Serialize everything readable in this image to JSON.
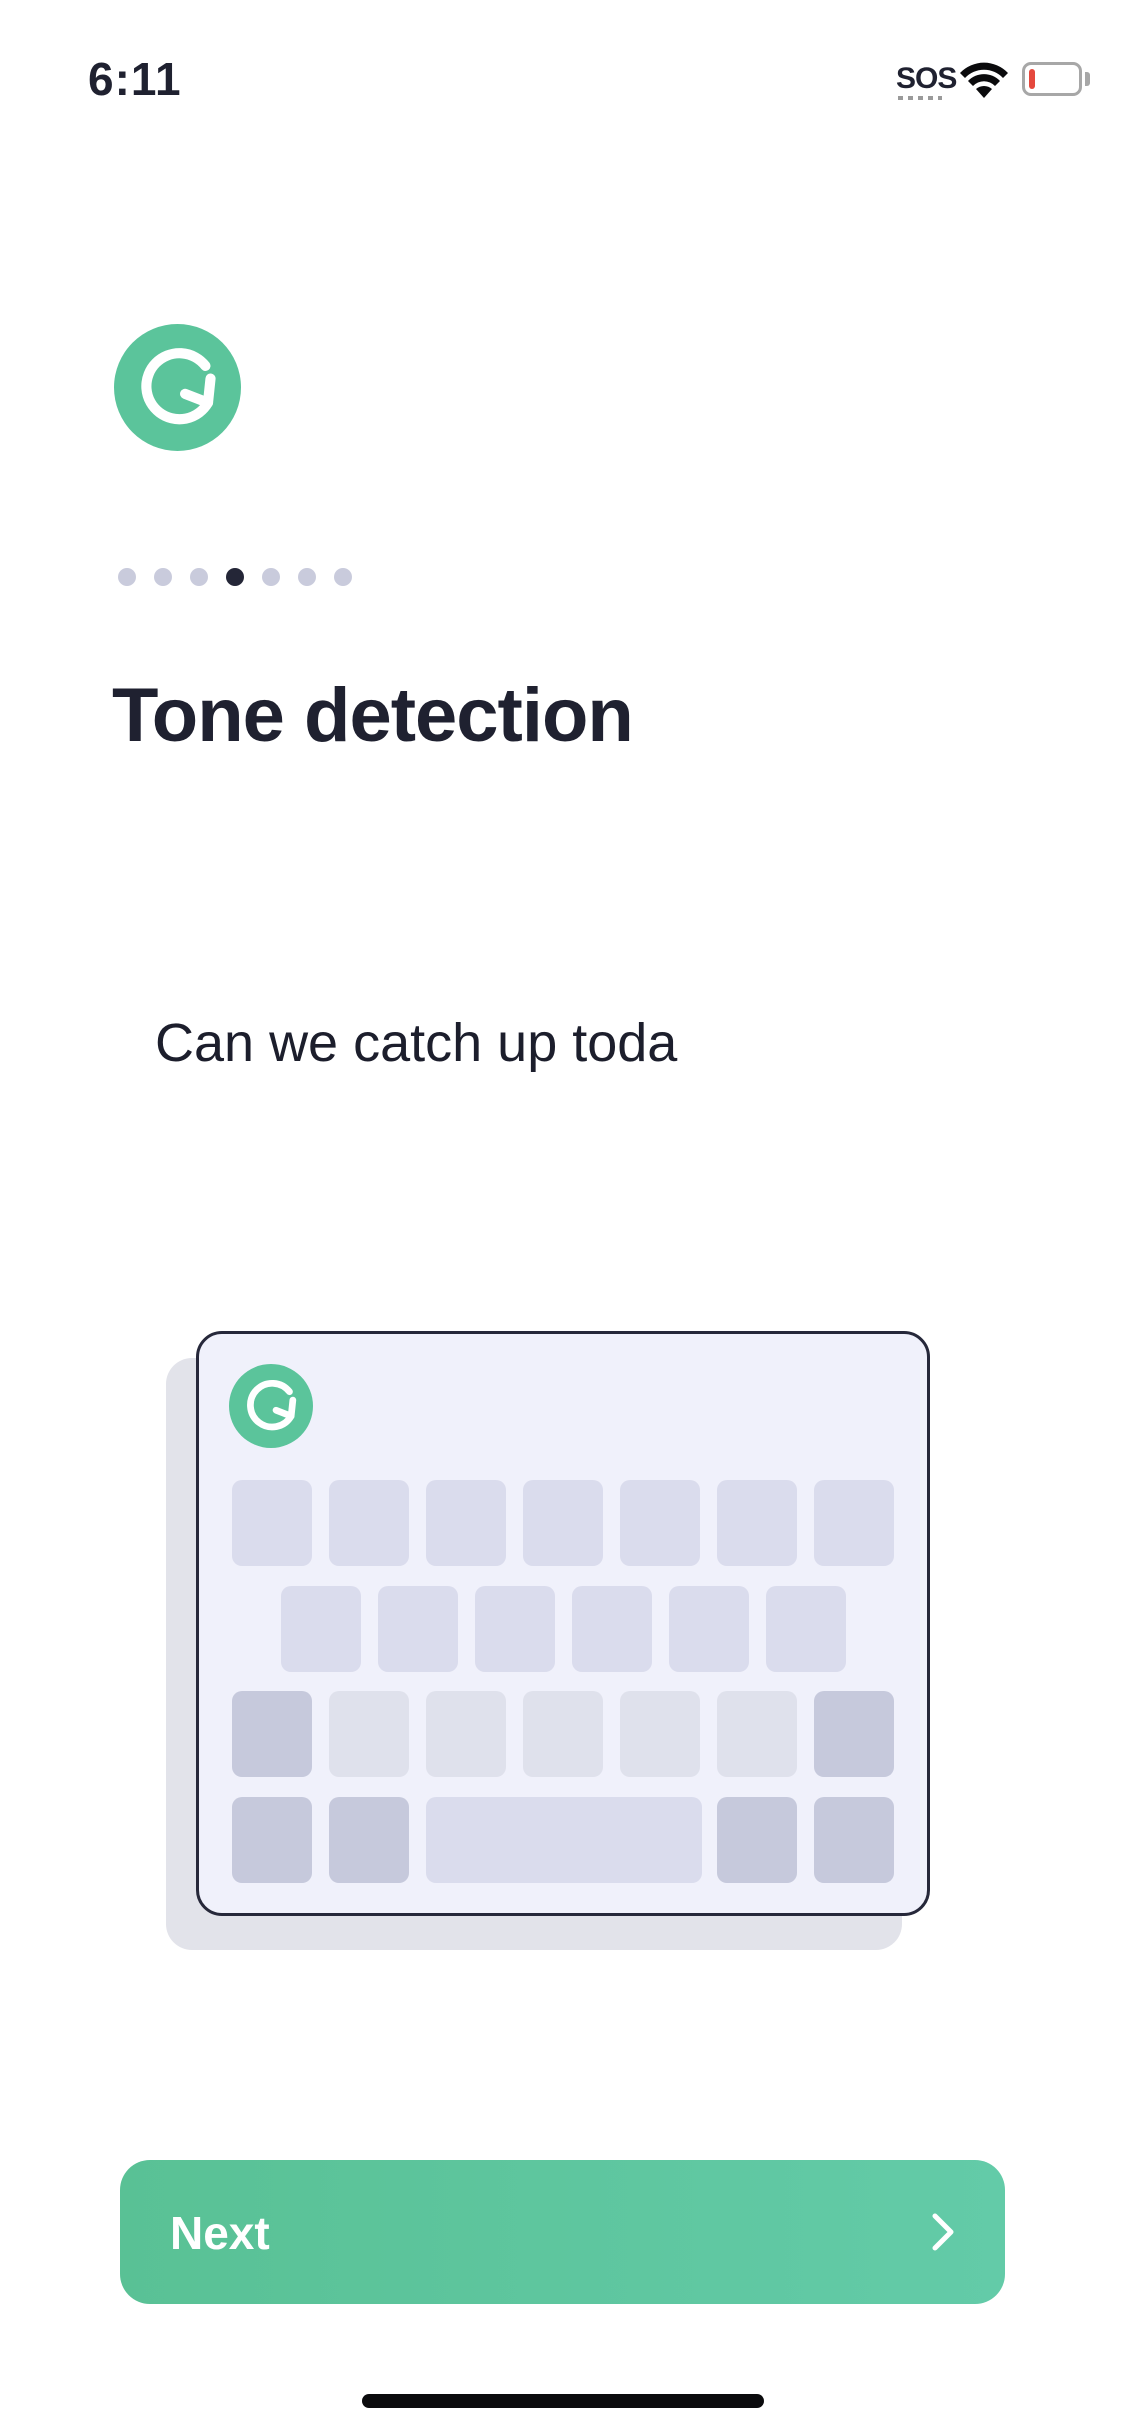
{
  "status_bar": {
    "time": "6:11",
    "sos": "SOS",
    "icons": [
      "wifi-icon",
      "battery-low-icon"
    ]
  },
  "app": {
    "logo": "grammarly-logo",
    "accent_color": "#5bc49b"
  },
  "onboarding": {
    "step_count": 7,
    "current_step": 4,
    "title": "Tone detection",
    "typed_text": "Can we catch up toda"
  },
  "illustration": {
    "keyboard_logo": "grammarly-logo"
  },
  "next_button": {
    "label": "Next",
    "icon": "chevron-right-icon",
    "color": "#5bc49b"
  }
}
